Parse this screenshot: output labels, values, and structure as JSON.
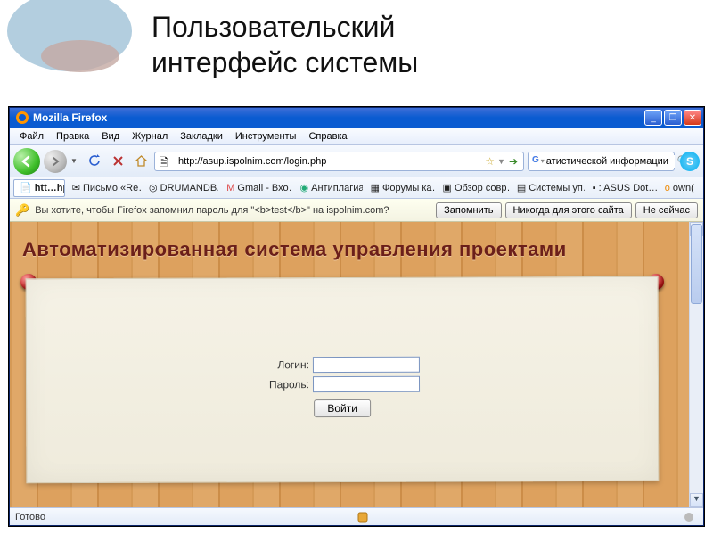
{
  "slide": {
    "heading_line1": "Пользовательский",
    "heading_line2": "интерфейс системы"
  },
  "window": {
    "title": "Mozilla Firefox",
    "min_label": "_",
    "max_label": "❐",
    "close_label": "✕"
  },
  "menu": {
    "file": "Файл",
    "edit": "Правка",
    "view": "Вид",
    "history": "Журнал",
    "bookmarks": "Закладки",
    "tools": "Инструменты",
    "help": "Справка"
  },
  "nav": {
    "url": "http://asup.ispolnim.com/login.php",
    "search_value": "атистической информации"
  },
  "bookmarks": [
    {
      "icon": "📄",
      "label": "htt…hp"
    },
    {
      "icon": "✉",
      "label": "Письмо «Re…"
    },
    {
      "icon": "◎",
      "label": "DRUMANDB…"
    },
    {
      "icon": "M",
      "label": "Gmail - Вхо…"
    },
    {
      "icon": "◉",
      "label": "Антиплагиат"
    },
    {
      "icon": "▦",
      "label": "Форумы ка…"
    },
    {
      "icon": "▣",
      "label": "Обзор совр…"
    },
    {
      "icon": "▤",
      "label": "Системы уп…"
    },
    {
      "icon": "▪",
      "label": ": ASUS Dot…"
    },
    {
      "icon": "о",
      "label": "own("
    }
  ],
  "infobar": {
    "message": "Вы хотите, чтобы Firefox запомнил пароль для \"<b>test</b>\" на ispolnim.com?",
    "remember": "Запомнить",
    "never": "Никогда для этого сайта",
    "not_now": "Не сейчас"
  },
  "page": {
    "banner": "Автоматизированная система управления проектами",
    "login_label": "Логин:",
    "password_label": "Пароль:",
    "submit_label": "Войти"
  },
  "status": {
    "text": "Готово"
  }
}
